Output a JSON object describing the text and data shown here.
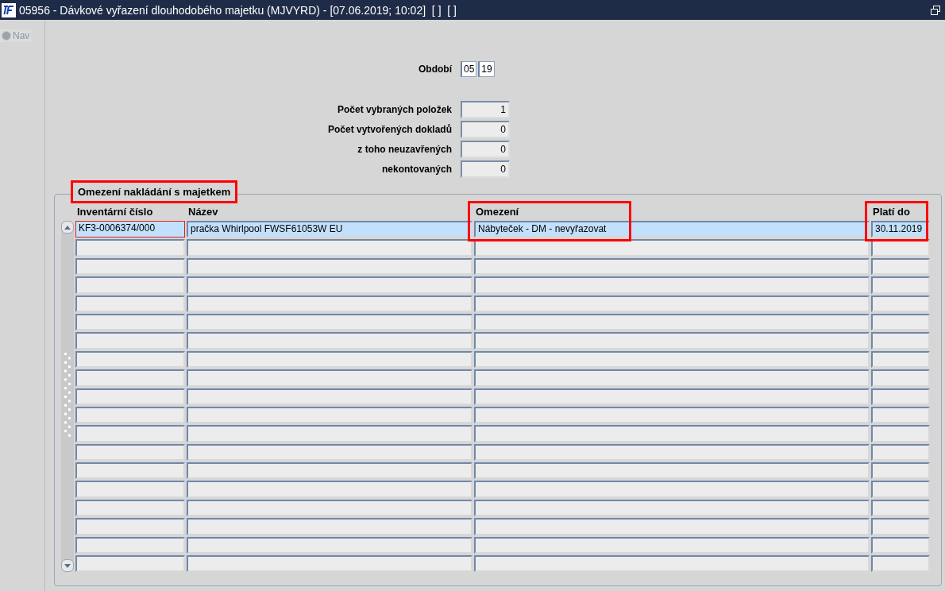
{
  "window": {
    "title": "05956 - Dávkové vyřazení dlouhodobého majetku (MJVYRD) - [07.06.2019; 10:02]  [ ]  [ ]"
  },
  "nav": {
    "label": "Nav",
    "selected": false
  },
  "period": {
    "label": "Období",
    "month": "05",
    "year": "19"
  },
  "counters": [
    {
      "label": "Počet vybraných položek",
      "value": "1"
    },
    {
      "label": "Počet vytvořených dokladů",
      "value": "0"
    },
    {
      "label": "z toho  neuzavřených",
      "value": "0"
    },
    {
      "label": "nekontovaných",
      "value": "0"
    }
  ],
  "section": {
    "title": "Omezení nakládání s majetkem",
    "highlighted": true
  },
  "table": {
    "columns": [
      {
        "label": "Inventární číslo",
        "highlighted": false
      },
      {
        "label": "Název",
        "highlighted": false
      },
      {
        "label": "Omezení",
        "highlighted": true
      },
      {
        "label": "Platí do",
        "highlighted": true
      }
    ],
    "rows": [
      {
        "selected": true,
        "cells": [
          {
            "text": "KF3-0006374/000",
            "focused": true
          },
          {
            "text": "pračka Whirlpool FWSF61053W EU",
            "focused": false
          },
          {
            "text": "Nábyteček - DM - nevyřazovat",
            "focused": false
          },
          {
            "text": "30.11.2019",
            "focused": false
          }
        ]
      }
    ]
  }
}
